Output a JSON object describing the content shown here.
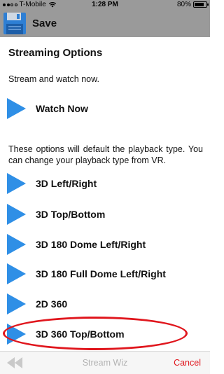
{
  "status_bar": {
    "carrier": "T-Mobile",
    "time": "1:28 PM",
    "battery": "80%",
    "battery_level": 0.8
  },
  "header": {
    "save_label": "Save",
    "save_icon": "floppy-disk-icon"
  },
  "content": {
    "title": "Streaming Options",
    "intro": "Stream and watch now.",
    "watch_now": "Watch Now",
    "description": "These options will default the playback type. You can change your playback type from VR.",
    "options": [
      "3D Left/Right",
      "3D Top/Bottom",
      "3D 180 Dome Left/Right",
      "3D 180 Full Dome Left/Right",
      "2D 360",
      "3D 360 Top/Bottom"
    ]
  },
  "toolbar": {
    "title": "Stream Wiz",
    "cancel": "Cancel"
  },
  "colors": {
    "header_bg": "#9a9a9a",
    "play_blue": "#2f8fe6",
    "annotation_red": "#e0161d",
    "cancel_red": "#e0161d"
  }
}
